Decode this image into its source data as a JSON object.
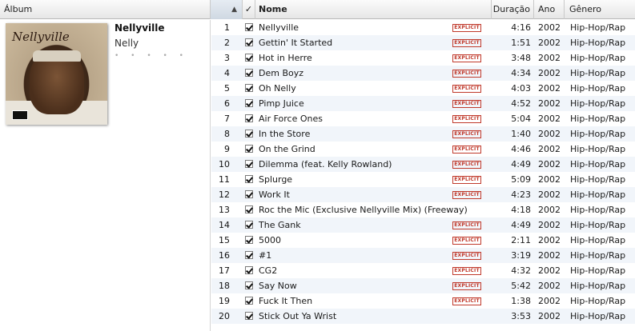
{
  "header": {
    "album": "Álbum",
    "sort_indicator": "▲",
    "check": "✓",
    "name": "Nome",
    "duration": "Duração",
    "year": "Ano",
    "genre": "Gênero"
  },
  "album": {
    "title": "Nellyville",
    "artist": "Nelly",
    "cover_text": "Nellyville",
    "rating": "• • • • •"
  },
  "explicit_label": "EXPLICIT",
  "tracks": [
    {
      "num": "1",
      "name": "Nellyville",
      "explicit": true,
      "duration": "4:16",
      "year": "2002",
      "genre": "Hip-Hop/Rap"
    },
    {
      "num": "2",
      "name": "Gettin' It Started",
      "explicit": true,
      "duration": "1:51",
      "year": "2002",
      "genre": "Hip-Hop/Rap"
    },
    {
      "num": "3",
      "name": "Hot in Herre",
      "explicit": true,
      "duration": "3:48",
      "year": "2002",
      "genre": "Hip-Hop/Rap"
    },
    {
      "num": "4",
      "name": "Dem Boyz",
      "explicit": true,
      "duration": "4:34",
      "year": "2002",
      "genre": "Hip-Hop/Rap"
    },
    {
      "num": "5",
      "name": "Oh Nelly",
      "explicit": true,
      "duration": "4:03",
      "year": "2002",
      "genre": "Hip-Hop/Rap"
    },
    {
      "num": "6",
      "name": "Pimp Juice",
      "explicit": true,
      "duration": "4:52",
      "year": "2002",
      "genre": "Hip-Hop/Rap"
    },
    {
      "num": "7",
      "name": "Air Force Ones",
      "explicit": true,
      "duration": "5:04",
      "year": "2002",
      "genre": "Hip-Hop/Rap"
    },
    {
      "num": "8",
      "name": "In the Store",
      "explicit": true,
      "duration": "1:40",
      "year": "2002",
      "genre": "Hip-Hop/Rap"
    },
    {
      "num": "9",
      "name": "On the Grind",
      "explicit": true,
      "duration": "4:46",
      "year": "2002",
      "genre": "Hip-Hop/Rap"
    },
    {
      "num": "10",
      "name": "Dilemma (feat. Kelly Rowland)",
      "explicit": true,
      "duration": "4:49",
      "year": "2002",
      "genre": "Hip-Hop/Rap"
    },
    {
      "num": "11",
      "name": "Splurge",
      "explicit": true,
      "duration": "5:09",
      "year": "2002",
      "genre": "Hip-Hop/Rap"
    },
    {
      "num": "12",
      "name": "Work It",
      "explicit": true,
      "duration": "4:23",
      "year": "2002",
      "genre": "Hip-Hop/Rap"
    },
    {
      "num": "13",
      "name": "Roc the Mic (Exclusive Nellyville Mix) (Freeway)",
      "explicit": false,
      "duration": "4:18",
      "year": "2002",
      "genre": "Hip-Hop/Rap"
    },
    {
      "num": "14",
      "name": "The Gank",
      "explicit": true,
      "duration": "4:49",
      "year": "2002",
      "genre": "Hip-Hop/Rap"
    },
    {
      "num": "15",
      "name": "5000",
      "explicit": true,
      "duration": "2:11",
      "year": "2002",
      "genre": "Hip-Hop/Rap"
    },
    {
      "num": "16",
      "name": "#1",
      "explicit": true,
      "duration": "3:19",
      "year": "2002",
      "genre": "Hip-Hop/Rap"
    },
    {
      "num": "17",
      "name": "CG2",
      "explicit": true,
      "duration": "4:32",
      "year": "2002",
      "genre": "Hip-Hop/Rap"
    },
    {
      "num": "18",
      "name": "Say Now",
      "explicit": true,
      "duration": "5:42",
      "year": "2002",
      "genre": "Hip-Hop/Rap"
    },
    {
      "num": "19",
      "name": "Fuck It Then",
      "explicit": true,
      "duration": "1:38",
      "year": "2002",
      "genre": "Hip-Hop/Rap"
    },
    {
      "num": "20",
      "name": "Stick Out Ya Wrist",
      "explicit": false,
      "duration": "3:53",
      "year": "2002",
      "genre": "Hip-Hop/Rap"
    }
  ],
  "colors": {
    "row_alt": "#f1f5fa",
    "explicit": "#c0392b",
    "header": "#e6e6e6"
  }
}
